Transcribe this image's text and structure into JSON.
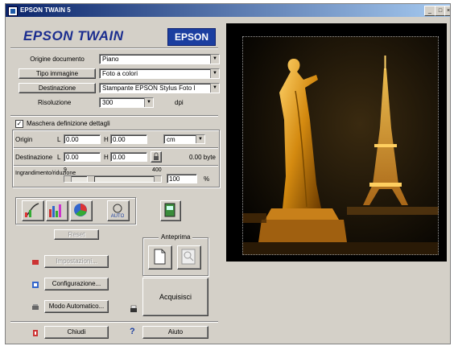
{
  "window": {
    "title": "EPSON TWAIN 5",
    "controls": [
      "_",
      "□",
      "×"
    ]
  },
  "header": {
    "brand": "EPSON TWAIN",
    "logo": "EPSON"
  },
  "settings": {
    "origine_label": "Origine documento",
    "origine_value": "Piano",
    "tipo_label": "Tipo immagine",
    "tipo_value": "Foto a colori",
    "destinazione_label": "Destinazione",
    "destinazione_value": "Stampante EPSON Stylus Foto I",
    "risoluzione_label": "Risoluzione",
    "risoluzione_value": "300",
    "risoluzione_unit": "dpi"
  },
  "mask": {
    "label": "Maschera definizione dettagli",
    "checked": true
  },
  "dimensions": {
    "orig_label": "Origin",
    "orig_l": "0.00",
    "orig_h": "0.00",
    "dest_label": "Destinazione",
    "dest_l": "0.00",
    "dest_h": "0.00",
    "l_label": "L",
    "h_label": "H",
    "units": "cm",
    "size": "0.00 byte",
    "scale_label": "Ingrandimento/riduzione",
    "scale_min": "9",
    "scale_max": "400",
    "scale_value": "100",
    "scale_pct": "%"
  },
  "tools": {
    "reset_label": "Reset",
    "anteprima_label": "Anteprima",
    "auto_label": "AUTO"
  },
  "actions": {
    "impostazioni_label": "Impostazioni...",
    "configurazione_label": "Configurazione...",
    "modo_label": "Modo Automatico...",
    "acquisisci_label": "Acquisisci",
    "chiudi_label": "Chiudi",
    "aiuto_label": "Aiuto"
  },
  "colors": {
    "title_bar": "#0a246a",
    "brand_text": "#1b2d8f",
    "logo_bg": "#1b3ea0",
    "face": "#d4d0c8"
  },
  "icons": [
    "epson-app-icon",
    "tone-correction-icon",
    "histogram-icon",
    "color-adjust-icon",
    "auto-exposure-icon",
    "film-icon",
    "page-preview-icon",
    "zoom-preview-icon",
    "settings-icon",
    "configuration-icon",
    "auto-mode-icon",
    "scan-icon",
    "exit-icon",
    "help-icon"
  ]
}
